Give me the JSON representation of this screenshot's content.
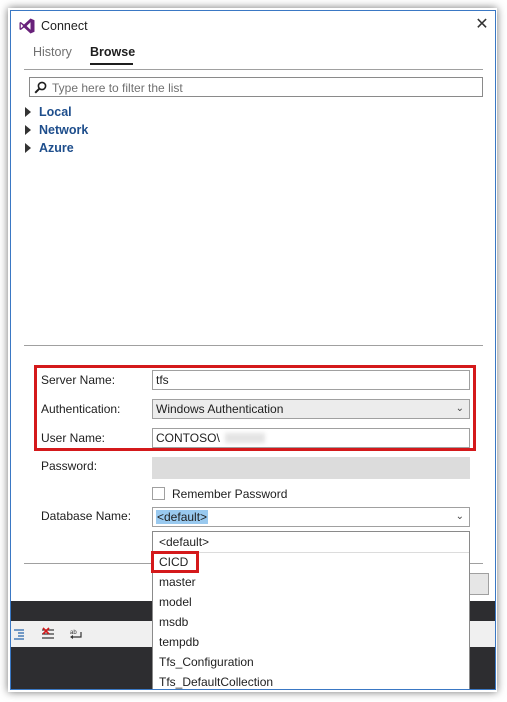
{
  "window": {
    "title": "Connect",
    "close_glyph": "✕"
  },
  "tabs": [
    {
      "label": "History",
      "active": false
    },
    {
      "label": "Browse",
      "active": true
    }
  ],
  "filter": {
    "placeholder": "Type here to filter the list"
  },
  "tree": [
    {
      "label": "Local"
    },
    {
      "label": "Network"
    },
    {
      "label": "Azure"
    }
  ],
  "form": {
    "server_name": {
      "label": "Server Name:",
      "value": "tfs"
    },
    "authentication": {
      "label": "Authentication:",
      "value": "Windows Authentication"
    },
    "user_name": {
      "label": "User Name:",
      "value": "CONTOSO\\"
    },
    "password": {
      "label": "Password:",
      "value": ""
    },
    "remember_password": {
      "label": "Remember Password",
      "checked": false
    },
    "database_name": {
      "label": "Database Name:",
      "value": "<default>"
    }
  },
  "database_options": [
    "<default>",
    "CICD",
    "master",
    "model",
    "msdb",
    "tempdb",
    "Tfs_Configuration",
    "Tfs_DefaultCollection"
  ],
  "colors": {
    "highlight": "#d4191b",
    "accent": "#3a78c4",
    "vs_purple": "#68217a",
    "tree_link": "#1e4e8c"
  },
  "icons": [
    "visual-studio-logo-icon",
    "close-icon",
    "search-icon",
    "expand-triangle-icon",
    "chevron-down-icon"
  ]
}
